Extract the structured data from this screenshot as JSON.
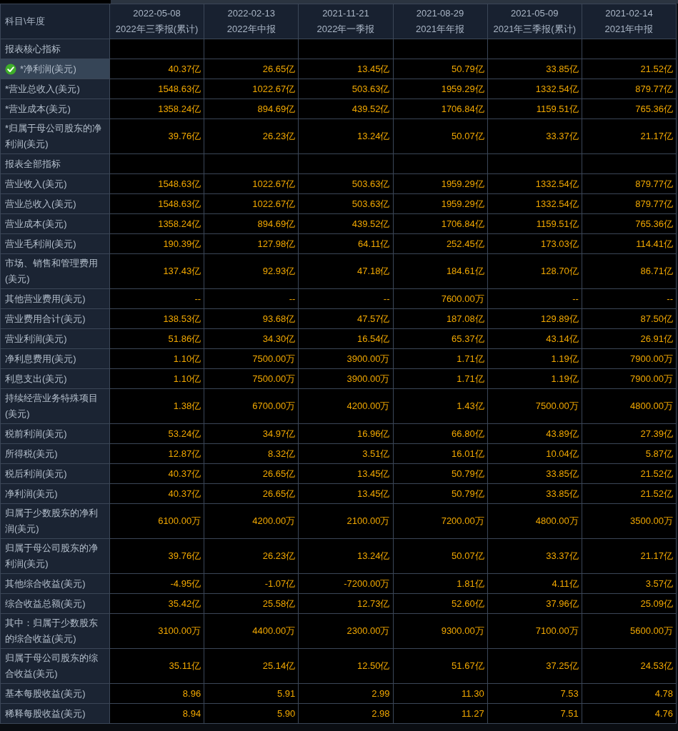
{
  "table": {
    "corner": "科目\\年度",
    "columns": [
      {
        "date": "2022-05-08",
        "report": "2022年三季报(累计)"
      },
      {
        "date": "2022-02-13",
        "report": "2022年中报"
      },
      {
        "date": "2021-11-21",
        "report": "2022年一季报"
      },
      {
        "date": "2021-08-29",
        "report": "2021年年报"
      },
      {
        "date": "2021-05-09",
        "report": "2021年三季报(累计)"
      },
      {
        "date": "2021-02-14",
        "report": "2021年中报"
      }
    ],
    "rows": [
      {
        "kind": "section",
        "label": "报表核心指标",
        "selected": false
      },
      {
        "kind": "data",
        "label": "*净利润(美元)",
        "selected": true,
        "values": [
          "40.37亿",
          "26.65亿",
          "13.45亿",
          "50.79亿",
          "33.85亿",
          "21.52亿"
        ]
      },
      {
        "kind": "data",
        "label": "*营业总收入(美元)",
        "selected": false,
        "values": [
          "1548.63亿",
          "1022.67亿",
          "503.63亿",
          "1959.29亿",
          "1332.54亿",
          "879.77亿"
        ]
      },
      {
        "kind": "data",
        "label": "*营业成本(美元)",
        "selected": false,
        "values": [
          "1358.24亿",
          "894.69亿",
          "439.52亿",
          "1706.84亿",
          "1159.51亿",
          "765.36亿"
        ]
      },
      {
        "kind": "data",
        "label": "*归属于母公司股东的净利润(美元)",
        "selected": false,
        "values": [
          "39.76亿",
          "26.23亿",
          "13.24亿",
          "50.07亿",
          "33.37亿",
          "21.17亿"
        ]
      },
      {
        "kind": "section",
        "label": "报表全部指标",
        "selected": false
      },
      {
        "kind": "data",
        "label": "营业收入(美元)",
        "selected": false,
        "values": [
          "1548.63亿",
          "1022.67亿",
          "503.63亿",
          "1959.29亿",
          "1332.54亿",
          "879.77亿"
        ]
      },
      {
        "kind": "data",
        "label": "营业总收入(美元)",
        "selected": false,
        "values": [
          "1548.63亿",
          "1022.67亿",
          "503.63亿",
          "1959.29亿",
          "1332.54亿",
          "879.77亿"
        ]
      },
      {
        "kind": "data",
        "label": "营业成本(美元)",
        "selected": false,
        "values": [
          "1358.24亿",
          "894.69亿",
          "439.52亿",
          "1706.84亿",
          "1159.51亿",
          "765.36亿"
        ]
      },
      {
        "kind": "data",
        "label": "营业毛利润(美元)",
        "selected": false,
        "values": [
          "190.39亿",
          "127.98亿",
          "64.11亿",
          "252.45亿",
          "173.03亿",
          "114.41亿"
        ]
      },
      {
        "kind": "data",
        "label": "市场、销售和管理费用(美元)",
        "selected": false,
        "values": [
          "137.43亿",
          "92.93亿",
          "47.18亿",
          "184.61亿",
          "128.70亿",
          "86.71亿"
        ]
      },
      {
        "kind": "data",
        "label": "其他营业费用(美元)",
        "selected": false,
        "values": [
          "--",
          "--",
          "--",
          "7600.00万",
          "--",
          "--"
        ]
      },
      {
        "kind": "data",
        "label": "营业费用合计(美元)",
        "selected": false,
        "values": [
          "138.53亿",
          "93.68亿",
          "47.57亿",
          "187.08亿",
          "129.89亿",
          "87.50亿"
        ]
      },
      {
        "kind": "data",
        "label": "营业利润(美元)",
        "selected": false,
        "values": [
          "51.86亿",
          "34.30亿",
          "16.54亿",
          "65.37亿",
          "43.14亿",
          "26.91亿"
        ]
      },
      {
        "kind": "data",
        "label": "净利息费用(美元)",
        "selected": false,
        "values": [
          "1.10亿",
          "7500.00万",
          "3900.00万",
          "1.71亿",
          "1.19亿",
          "7900.00万"
        ]
      },
      {
        "kind": "data",
        "label": "利息支出(美元)",
        "selected": false,
        "values": [
          "1.10亿",
          "7500.00万",
          "3900.00万",
          "1.71亿",
          "1.19亿",
          "7900.00万"
        ]
      },
      {
        "kind": "data",
        "label": "持续经营业务特殊项目(美元)",
        "selected": false,
        "values": [
          "1.38亿",
          "6700.00万",
          "4200.00万",
          "1.43亿",
          "7500.00万",
          "4800.00万"
        ]
      },
      {
        "kind": "data",
        "label": "税前利润(美元)",
        "selected": false,
        "values": [
          "53.24亿",
          "34.97亿",
          "16.96亿",
          "66.80亿",
          "43.89亿",
          "27.39亿"
        ]
      },
      {
        "kind": "data",
        "label": "所得税(美元)",
        "selected": false,
        "values": [
          "12.87亿",
          "8.32亿",
          "3.51亿",
          "16.01亿",
          "10.04亿",
          "5.87亿"
        ]
      },
      {
        "kind": "data",
        "label": "税后利润(美元)",
        "selected": false,
        "values": [
          "40.37亿",
          "26.65亿",
          "13.45亿",
          "50.79亿",
          "33.85亿",
          "21.52亿"
        ]
      },
      {
        "kind": "data",
        "label": "净利润(美元)",
        "selected": false,
        "values": [
          "40.37亿",
          "26.65亿",
          "13.45亿",
          "50.79亿",
          "33.85亿",
          "21.52亿"
        ]
      },
      {
        "kind": "data",
        "label": "归属于少数股东的净利润(美元)",
        "selected": false,
        "values": [
          "6100.00万",
          "4200.00万",
          "2100.00万",
          "7200.00万",
          "4800.00万",
          "3500.00万"
        ]
      },
      {
        "kind": "data",
        "label": "归属于母公司股东的净利润(美元)",
        "selected": false,
        "values": [
          "39.76亿",
          "26.23亿",
          "13.24亿",
          "50.07亿",
          "33.37亿",
          "21.17亿"
        ]
      },
      {
        "kind": "data",
        "label": "其他综合收益(美元)",
        "selected": false,
        "values": [
          "-4.95亿",
          "-1.07亿",
          "-7200.00万",
          "1.81亿",
          "4.11亿",
          "3.57亿"
        ]
      },
      {
        "kind": "data",
        "label": "综合收益总额(美元)",
        "selected": false,
        "values": [
          "35.42亿",
          "25.58亿",
          "12.73亿",
          "52.60亿",
          "37.96亿",
          "25.09亿"
        ]
      },
      {
        "kind": "data",
        "label": "其中：归属于少数股东的综合收益(美元)",
        "selected": false,
        "values": [
          "3100.00万",
          "4400.00万",
          "2300.00万",
          "9300.00万",
          "7100.00万",
          "5600.00万"
        ]
      },
      {
        "kind": "data",
        "label": "归属于母公司股东的综合收益(美元)",
        "selected": false,
        "values": [
          "35.11亿",
          "25.14亿",
          "12.50亿",
          "51.67亿",
          "37.25亿",
          "24.53亿"
        ]
      },
      {
        "kind": "data",
        "label": "基本每股收益(美元)",
        "selected": false,
        "values": [
          "8.96",
          "5.91",
          "2.99",
          "11.30",
          "7.53",
          "4.78"
        ]
      },
      {
        "kind": "data",
        "label": "稀释每股收益(美元)",
        "selected": false,
        "values": [
          "8.94",
          "5.90",
          "2.98",
          "11.27",
          "7.51",
          "4.76"
        ]
      }
    ]
  }
}
